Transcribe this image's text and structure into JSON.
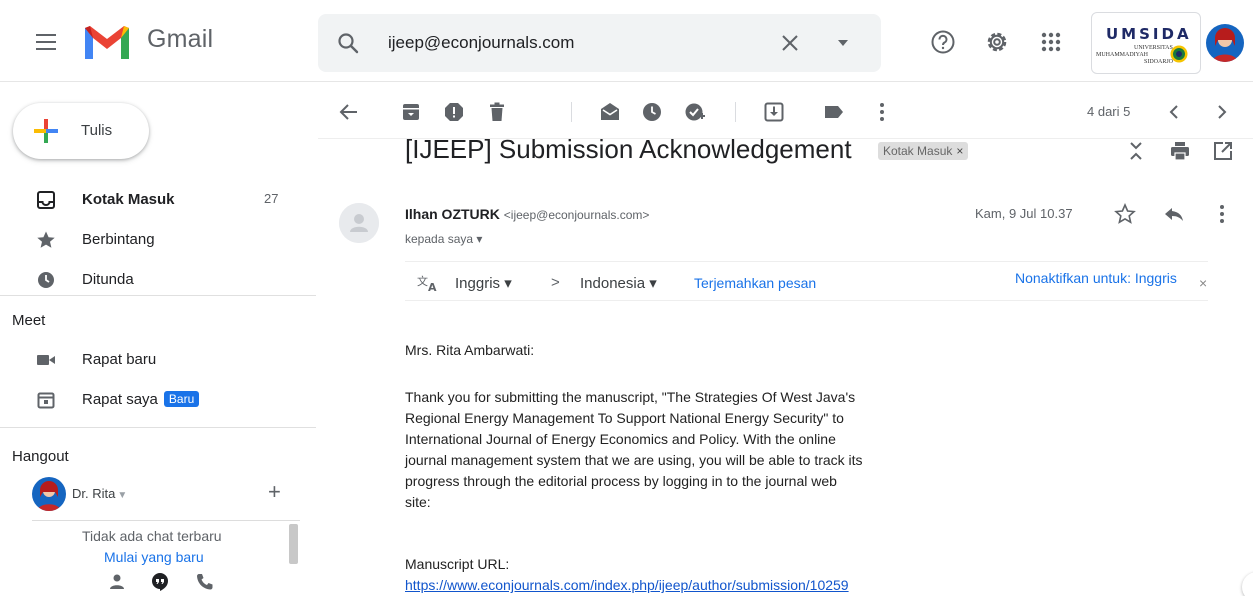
{
  "header": {
    "app_name": "Gmail",
    "search_value": "ijeep@econjournals.com",
    "org_logo": {
      "title": "UMSIDA",
      "line1": "UNIVERSITAS",
      "line2": "MUHAMMADIYAH",
      "line3": "SIDOARJO"
    },
    "icons": [
      "menu-icon",
      "search-icon",
      "close-icon",
      "dropdown-icon",
      "help-icon",
      "settings-icon",
      "apps-icon"
    ]
  },
  "sidebar": {
    "compose_label": "Tulis",
    "items": [
      {
        "label": "Kotak Masuk",
        "count": "27",
        "icon": "inbox-icon"
      },
      {
        "label": "Berbintang",
        "icon": "star-icon"
      },
      {
        "label": "Ditunda",
        "icon": "clock-icon"
      }
    ],
    "meet_title": "Meet",
    "meet_items": [
      {
        "label": "Rapat baru",
        "icon": "video-icon"
      },
      {
        "label": "Rapat saya",
        "badge": "Baru",
        "icon": "calendar-icon"
      }
    ],
    "hangout_title": "Hangout",
    "hangout_user": "Dr. Rita",
    "chat_empty": "Tidak ada chat terbaru",
    "chat_start": "Mulai yang baru"
  },
  "toolbar": {
    "pager": "4 dari 5"
  },
  "message": {
    "subject": "[IJEEP] Submission Acknowledgement",
    "label_chip": "Kotak Masuk",
    "label_close": "×",
    "sender_name": "Ilhan OZTURK",
    "sender_email": "<ijeep@econjournals.com>",
    "to_me": "kepada saya",
    "date": "Kam, 9 Jul 10.37",
    "translation": {
      "source": "Inggris",
      "arrow": ">",
      "target": "Indonesia",
      "translate_link": "Terjemahkan pesan",
      "disable_link": "Nonaktifkan untuk: Inggris",
      "close": "×"
    },
    "greeting": "Mrs. Rita Ambarwati:",
    "paragraph_lines": [
      "Thank you for submitting the manuscript, \"The Strategies Of West Java's",
      "Regional Energy Management To Support National Energy Security\" to",
      "International Journal of Energy Economics and Policy. With the online",
      "journal management system that we are using, you will be able to track its",
      "progress through the editorial process by logging in to the journal web",
      "site:"
    ],
    "manuscript_label": "Manuscript URL:",
    "manuscript_url": "https://www.econjournals.com/index.php/ijeep/author/submission/10259"
  },
  "colors": {
    "accent_blue": "#1a73e8",
    "link_blue": "#1155cc",
    "gmail_red": "#ea4335"
  }
}
